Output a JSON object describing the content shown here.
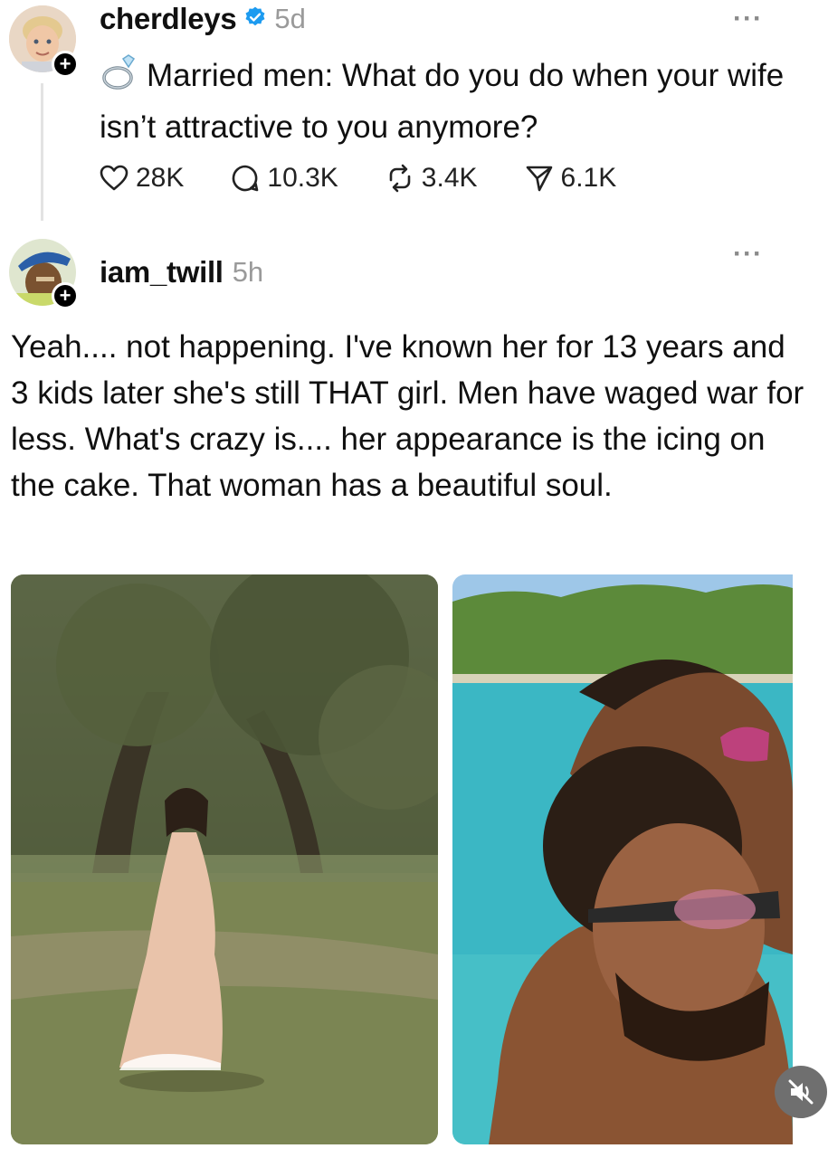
{
  "colors": {
    "verified": "#1d9bf0",
    "muted": "#9a9a9a",
    "text": "#101010"
  },
  "original_post": {
    "username": "cherdleys",
    "verified": true,
    "time": "5d",
    "text": "Married men: What do you do when your wife isn’t attractive to you anymore?",
    "ring_icon": "ring-icon",
    "stats": {
      "likes": "28K",
      "replies": "10.3K",
      "reposts": "3.4K",
      "shares": "6.1K"
    }
  },
  "reply": {
    "username": "iam_twill",
    "time": "5h",
    "text": "Yeah.... not happening. I've known her for 13 years and 3 kids later she's still THAT girl. Men have waged war for less. What's crazy is.... her appearance is the icing on the cake. That woman has a beautiful soul.",
    "media": [
      {
        "name": "woman-in-park-photo"
      },
      {
        "name": "couple-in-water-photo"
      }
    ],
    "mute_icon": "speaker-muted-icon"
  }
}
